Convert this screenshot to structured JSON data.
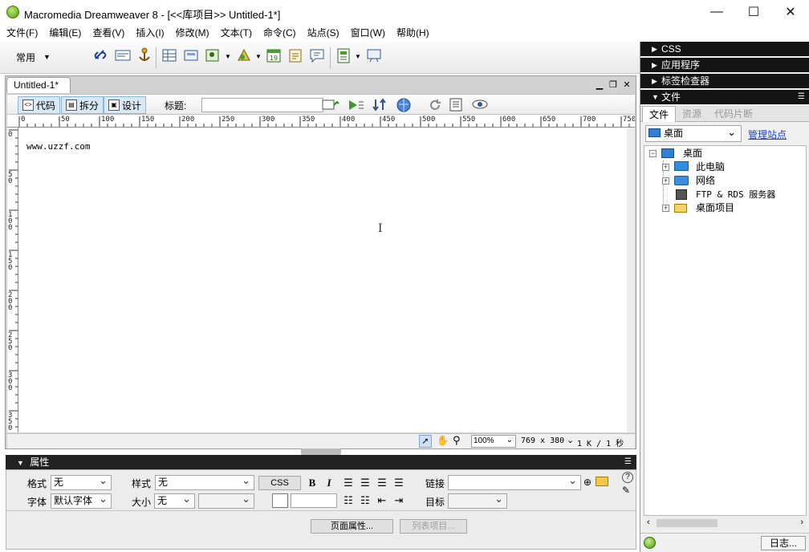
{
  "window": {
    "title": "Macromedia Dreamweaver 8 - [<<库项目>> Untitled-1*]",
    "minimize": "—",
    "maximize": "☐",
    "close": "✕"
  },
  "menu": [
    "文件(F)",
    "编辑(E)",
    "查看(V)",
    "插入(I)",
    "修改(M)",
    "文本(T)",
    "命令(C)",
    "站点(S)",
    "窗口(W)",
    "帮助(H)"
  ],
  "toolbar": {
    "category": "常用",
    "icons": [
      "hyperlink-icon",
      "email-link-icon",
      "named-anchor-icon",
      "table-icon",
      "layer-icon",
      "image-icon",
      "media-icon",
      "date-icon",
      "comment-icon",
      "tag-chooser-icon",
      "template-icon",
      "head-content-icon"
    ]
  },
  "document": {
    "tab_label": "Untitled-1*",
    "views": {
      "code": "代码",
      "split": "拆分",
      "design": "设计"
    },
    "title_label": "标题:",
    "title_value": "",
    "content_text": "www.uzzf.com"
  },
  "ruler": {
    "top_ticks": [
      "0",
      "50",
      "100",
      "150",
      "200",
      "250",
      "300",
      "350",
      "400",
      "450",
      "500",
      "550",
      "600",
      "650",
      "700",
      "750"
    ],
    "left_ticks": [
      "0",
      "50",
      "100",
      "150",
      "200",
      "250",
      "300",
      "350"
    ]
  },
  "status": {
    "zoom": "100%",
    "dimensions": "769 x 380",
    "download": "1 K / 1 秒"
  },
  "properties": {
    "header": "属性",
    "format_label": "格式",
    "format_value": "无",
    "style_label": "样式",
    "style_value": "无",
    "css_button": "CSS",
    "bold": "B",
    "italic": "I",
    "link_label": "链接",
    "link_value": "",
    "font_label": "字体",
    "font_value": "默认字体",
    "size_label": "大小",
    "size_value": "无",
    "target_label": "目标",
    "page_props_button": "页面属性...",
    "list_item_button": "列表项目..."
  },
  "right_panel": {
    "headers": [
      "CSS",
      "应用程序",
      "标签检查器",
      "文件"
    ],
    "file_tabs": [
      "文件",
      "资源",
      "代码片断"
    ],
    "site_value": "桌面",
    "manage_sites": "管理站点",
    "tree": [
      {
        "label": "桌面",
        "icon": "desktop-icon"
      },
      {
        "label": "此电脑",
        "icon": "computer-icon"
      },
      {
        "label": "网络",
        "icon": "network-icon"
      },
      {
        "label": "FTP & RDS 服务器",
        "icon": "server-icon"
      },
      {
        "label": "桌面项目",
        "icon": "folder-icon"
      }
    ],
    "log_button": "日志..."
  }
}
